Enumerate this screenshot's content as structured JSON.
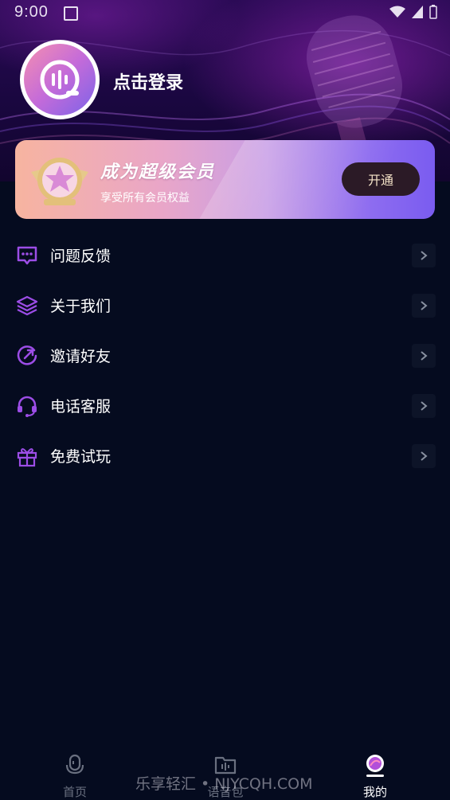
{
  "status_bar": {
    "time": "9:00"
  },
  "profile": {
    "login_text": "点击登录"
  },
  "vip": {
    "title": "成为超级会员",
    "subtitle": "享受所有会员权益",
    "button_label": "开通"
  },
  "menu": {
    "items": [
      {
        "label": "问题反馈",
        "icon": "feedback-icon"
      },
      {
        "label": "关于我们",
        "icon": "layers-icon"
      },
      {
        "label": "邀请好友",
        "icon": "invite-icon"
      },
      {
        "label": "电话客服",
        "icon": "headset-icon"
      },
      {
        "label": "免费试玩",
        "icon": "gift-icon"
      }
    ]
  },
  "tabbar": {
    "tabs": [
      {
        "label": "首页",
        "icon": "microphone-icon"
      },
      {
        "label": "语音包",
        "icon": "folder-audio-icon"
      },
      {
        "label": "我的",
        "icon": "profile-icon"
      }
    ],
    "active_index": 2
  },
  "watermark": "乐享轻汇 • NJYCQH.COM",
  "colors": {
    "accent_purple": "#8a3fe0",
    "background": "#050b1f",
    "vip_button_text": "#f5e3c8"
  }
}
